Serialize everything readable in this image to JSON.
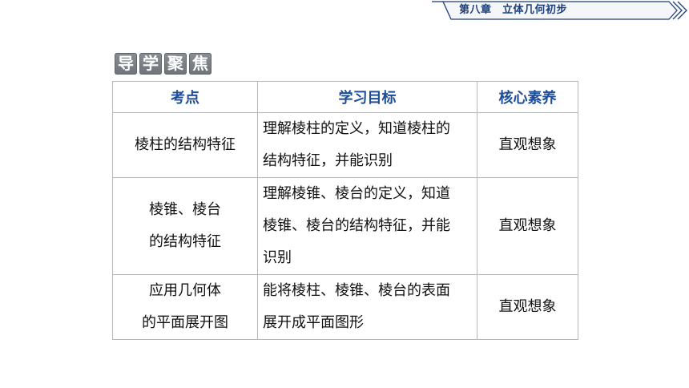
{
  "header": {
    "chapter": "第八章　立体几何初步",
    "colors": {
      "banner_text": "#1d3f78",
      "banner_line": "#1d3f78"
    }
  },
  "section_title": {
    "chars": [
      "导",
      "学",
      "聚",
      "焦"
    ]
  },
  "table": {
    "headers": [
      "考点",
      "学习目标",
      "核心素养"
    ],
    "rows": [
      {
        "topic": [
          "棱柱的结构特征"
        ],
        "goal": [
          "理解棱柱的定义，知道棱柱的",
          "结构特征，并能识别"
        ],
        "literacy": "直观想象"
      },
      {
        "topic": [
          "棱锥、棱台",
          "的结构特征"
        ],
        "goal": [
          "理解棱锥、棱台的定义，知道",
          "棱锥、棱台的结构特征，并能",
          "识别"
        ],
        "literacy": "直观想象"
      },
      {
        "topic": [
          "应用几何体",
          "的平面展开图"
        ],
        "goal": [
          "能将棱柱、棱锥、棱台的表面",
          "展开成平面图形"
        ],
        "literacy": "直观想象"
      }
    ],
    "colors": {
      "header_text": "#1e4d97",
      "border": "#b8b8b8"
    }
  }
}
